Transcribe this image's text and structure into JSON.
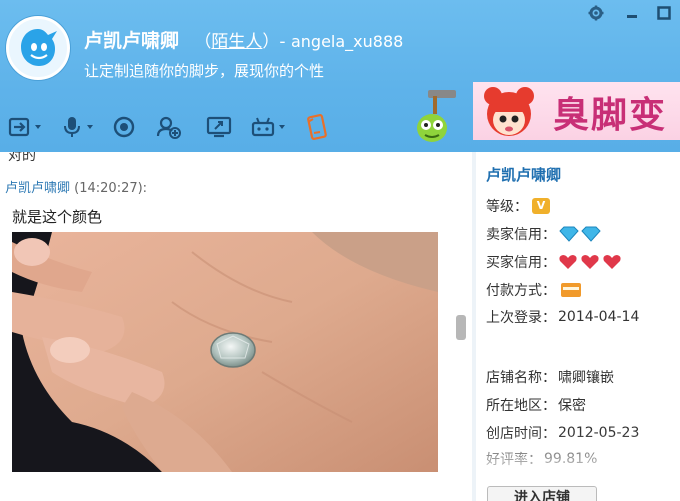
{
  "window": {
    "contact_name": "卢凯卢啸卿",
    "relation": "陌生人",
    "account": "angela_xu888",
    "signature": "让定制追随你的脚步，展现你的个性",
    "controls": [
      "settings-icon",
      "minimize-icon",
      "maximize-icon"
    ]
  },
  "toolbar": {
    "items": [
      "file-transfer-icon",
      "voice-icon",
      "video-icon",
      "add-contact-icon",
      "screen-share-icon",
      "remote-assist-icon",
      "phone-note-icon"
    ]
  },
  "banner": {
    "text": "臭脚变"
  },
  "chat": {
    "previous_message_tail": "对的",
    "sender": "卢凯卢啸卿",
    "time": "(14:20:27):",
    "message": "就是这个颜色",
    "image_alt": "hand-with-gem-ring-photo"
  },
  "seller": {
    "name": "卢凯卢啸卿",
    "level_label": "等级：",
    "level_badge": "V",
    "seller_credit_label": "卖家信用：",
    "buyer_credit_label": "买家信用：",
    "payment_label": "付款方式：",
    "last_login_label": "上次登录：",
    "last_login_value": "2014-04-14",
    "shop_name_label": "店铺名称：",
    "shop_name_value": "啸卿镶嵌",
    "region_label": "所在地区：",
    "region_value": "保密",
    "founded_label": "创店时间：",
    "founded_value": "2012-05-23",
    "rating_label": "好评率：",
    "rating_value": "99.81%",
    "enter_shop_label": "进入店铺"
  },
  "colors": {
    "titlebar": "#5fb3ea",
    "name_link": "#1f6fb0",
    "diamond": "#3fb6e8",
    "heart": "#e0384a",
    "banner_text": "#c82f76"
  }
}
